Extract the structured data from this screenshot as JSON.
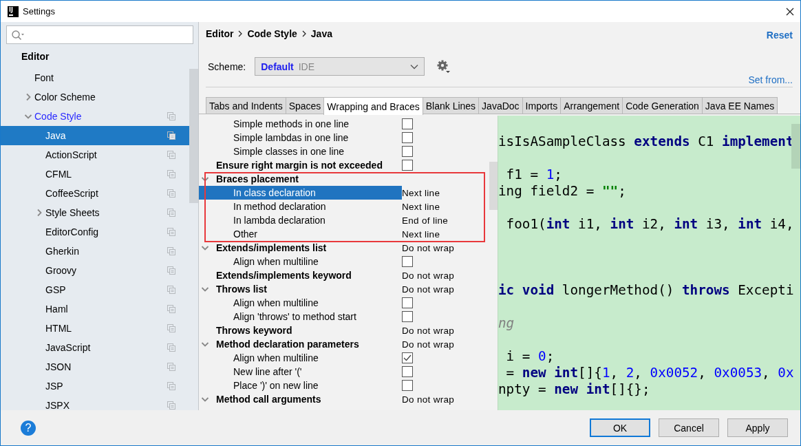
{
  "window": {
    "icon_label": "IJ",
    "title": "Settings"
  },
  "sidebar": {
    "heading": "Editor",
    "items": [
      {
        "label": "Font",
        "selected": false,
        "modified": false,
        "scheme_icon": false
      },
      {
        "label": "Color Scheme",
        "selected": false,
        "modified": false,
        "scheme_icon": false,
        "expanded": false
      },
      {
        "label": "Code Style",
        "selected": false,
        "modified": true,
        "scheme_icon": true,
        "expanded": true,
        "children": [
          {
            "label": "Java",
            "selected": true,
            "modified": false,
            "scheme_icon": true
          },
          {
            "label": "ActionScript",
            "selected": false,
            "modified": false,
            "scheme_icon": true
          },
          {
            "label": "CFML",
            "selected": false,
            "modified": false,
            "scheme_icon": true
          },
          {
            "label": "CoffeeScript",
            "selected": false,
            "modified": false,
            "scheme_icon": true
          },
          {
            "label": "Style Sheets",
            "selected": false,
            "modified": false,
            "scheme_icon": true,
            "expanded": false
          },
          {
            "label": "EditorConfig",
            "selected": false,
            "modified": false,
            "scheme_icon": true
          },
          {
            "label": "Gherkin",
            "selected": false,
            "modified": false,
            "scheme_icon": true
          },
          {
            "label": "Groovy",
            "selected": false,
            "modified": false,
            "scheme_icon": true
          },
          {
            "label": "GSP",
            "selected": false,
            "modified": false,
            "scheme_icon": true
          },
          {
            "label": "Haml",
            "selected": false,
            "modified": false,
            "scheme_icon": true
          },
          {
            "label": "HTML",
            "selected": false,
            "modified": false,
            "scheme_icon": true
          },
          {
            "label": "JavaScript",
            "selected": false,
            "modified": false,
            "scheme_icon": true
          },
          {
            "label": "JSON",
            "selected": false,
            "modified": false,
            "scheme_icon": true
          },
          {
            "label": "JSP",
            "selected": false,
            "modified": false,
            "scheme_icon": true
          },
          {
            "label": "JSPX",
            "selected": false,
            "modified": false,
            "scheme_icon": true
          }
        ]
      }
    ]
  },
  "breadcrumb": [
    "Editor",
    "Code Style",
    "Java"
  ],
  "reset_link": "Reset",
  "scheme": {
    "label": "Scheme:",
    "name": "Default",
    "type": "IDE"
  },
  "set_from_link": "Set from...",
  "tabs": [
    {
      "label": "Tabs and Indents",
      "selected": false
    },
    {
      "label": "Spaces",
      "selected": false
    },
    {
      "label": "Wrapping and Braces",
      "selected": true
    },
    {
      "label": "Blank Lines",
      "selected": false
    },
    {
      "label": "JavaDoc",
      "selected": false
    },
    {
      "label": "Imports",
      "selected": false
    },
    {
      "label": "Arrangement",
      "selected": false
    },
    {
      "label": "Code Generation",
      "selected": false
    },
    {
      "label": "Java EE Names",
      "selected": false
    }
  ],
  "options": [
    {
      "kind": "continued",
      "children": [
        {
          "kind": "checkbox",
          "label": "Simple methods in one line",
          "checked": false,
          "selected": false
        },
        {
          "kind": "checkbox",
          "label": "Simple lambdas in one line",
          "checked": false,
          "selected": false
        },
        {
          "kind": "checkbox",
          "label": "Simple classes in one line",
          "checked": false,
          "selected": false
        }
      ]
    },
    {
      "kind": "checkbox",
      "label": "Ensure right margin is not exceeded",
      "checked": false,
      "selected": false
    },
    {
      "kind": "heading",
      "label": "Braces placement",
      "expanded": true,
      "highlighted": true,
      "selected": false,
      "children": [
        {
          "kind": "choice",
          "label": "In class declaration",
          "value": "Next line",
          "selected": true
        },
        {
          "kind": "choice",
          "label": "In method declaration",
          "value": "Next line",
          "selected": false
        },
        {
          "kind": "choice",
          "label": "In lambda declaration",
          "value": "End of line",
          "selected": false
        },
        {
          "kind": "choice",
          "label": "Other",
          "value": "Next line",
          "selected": false
        }
      ]
    },
    {
      "kind": "choice",
      "label": "Extends/implements list",
      "value": "Do not wrap",
      "expanded": true,
      "highlighted": false,
      "selected": false,
      "children": [
        {
          "kind": "checkbox",
          "label": "Align when multiline",
          "checked": false,
          "selected": false
        }
      ]
    },
    {
      "kind": "choice",
      "label": "Extends/implements keyword",
      "value": "Do not wrap",
      "selected": false
    },
    {
      "kind": "choice",
      "label": "Throws list",
      "value": "Do not wrap",
      "expanded": true,
      "highlighted": false,
      "selected": false,
      "children": [
        {
          "kind": "checkbox",
          "label": "Align when multiline",
          "checked": false,
          "selected": false
        },
        {
          "kind": "checkbox",
          "label": "Align 'throws' to method start",
          "checked": false,
          "selected": false
        }
      ]
    },
    {
      "kind": "choice",
      "label": "Throws keyword",
      "value": "Do not wrap",
      "selected": false
    },
    {
      "kind": "choice",
      "label": "Method declaration parameters",
      "value": "Do not wrap",
      "expanded": true,
      "highlighted": false,
      "selected": false,
      "children": [
        {
          "kind": "checkbox",
          "label": "Align when multiline",
          "checked": true,
          "selected": false
        },
        {
          "kind": "checkbox",
          "label": "New line after '('",
          "checked": false,
          "selected": false
        },
        {
          "kind": "checkbox",
          "label": "Place ')' on new line",
          "checked": false,
          "selected": false
        }
      ]
    },
    {
      "kind": "choice",
      "label": "Method call arguments",
      "value": "Do not wrap",
      "expanded": true,
      "highlighted": false,
      "selected": false
    }
  ],
  "code_preview": [
    {
      "kind": "blank"
    },
    {
      "kind": "code",
      "tokens": [
        {
          "kind": "plain",
          "text": "isIsASampleClass "
        },
        {
          "kind": "keyword",
          "text": "extends"
        },
        {
          "kind": "plain",
          "text": " C1 "
        },
        {
          "kind": "keyword",
          "text": "implement"
        }
      ]
    },
    {
      "kind": "blank"
    },
    {
      "kind": "code",
      "tokens": [
        {
          "kind": "plain",
          "text": " f1 = "
        },
        {
          "kind": "number",
          "text": "1"
        },
        {
          "kind": "plain",
          "text": ";"
        }
      ]
    },
    {
      "kind": "code",
      "tokens": [
        {
          "kind": "plain",
          "text": "ing field2 = "
        },
        {
          "kind": "string",
          "text": "\"\""
        },
        {
          "kind": "plain",
          "text": ";"
        }
      ]
    },
    {
      "kind": "blank"
    },
    {
      "kind": "code",
      "tokens": [
        {
          "kind": "plain",
          "text": " foo1("
        },
        {
          "kind": "keyword",
          "text": "int"
        },
        {
          "kind": "plain",
          "text": " i1, "
        },
        {
          "kind": "keyword",
          "text": "int"
        },
        {
          "kind": "plain",
          "text": " i2, "
        },
        {
          "kind": "keyword",
          "text": "int"
        },
        {
          "kind": "plain",
          "text": " i3, "
        },
        {
          "kind": "keyword",
          "text": "int"
        },
        {
          "kind": "plain",
          "text": " i4,"
        }
      ]
    },
    {
      "kind": "blank"
    },
    {
      "kind": "blank"
    },
    {
      "kind": "blank"
    },
    {
      "kind": "code",
      "tokens": [
        {
          "kind": "keyword",
          "text": "ic"
        },
        {
          "kind": "keyword",
          "text": " void"
        },
        {
          "kind": "plain",
          "text": " longerMethod() "
        },
        {
          "kind": "keyword",
          "text": "throws"
        },
        {
          "kind": "plain",
          "text": " Excepti"
        }
      ]
    },
    {
      "kind": "blank"
    },
    {
      "kind": "code",
      "tokens": [
        {
          "kind": "comment",
          "text": "ng"
        }
      ]
    },
    {
      "kind": "blank"
    },
    {
      "kind": "code",
      "tokens": [
        {
          "kind": "plain",
          "text": " i = "
        },
        {
          "kind": "number",
          "text": "0"
        },
        {
          "kind": "plain",
          "text": ";"
        }
      ]
    },
    {
      "kind": "code",
      "tokens": [
        {
          "kind": "plain",
          "text": " = "
        },
        {
          "kind": "keyword",
          "text": "new"
        },
        {
          "kind": "keyword",
          "text": " int"
        },
        {
          "kind": "plain",
          "text": "[]{"
        },
        {
          "kind": "number",
          "text": "1"
        },
        {
          "kind": "plain",
          "text": ", "
        },
        {
          "kind": "number",
          "text": "2"
        },
        {
          "kind": "plain",
          "text": ", "
        },
        {
          "kind": "number",
          "text": "0x0052"
        },
        {
          "kind": "plain",
          "text": ", "
        },
        {
          "kind": "number",
          "text": "0x0053"
        },
        {
          "kind": "plain",
          "text": ", "
        },
        {
          "kind": "number",
          "text": "0x"
        }
      ]
    },
    {
      "kind": "code",
      "tokens": [
        {
          "kind": "plain",
          "text": "npty = "
        },
        {
          "kind": "keyword",
          "text": "new"
        },
        {
          "kind": "keyword",
          "text": " int"
        },
        {
          "kind": "plain",
          "text": "[]{};"
        }
      ]
    }
  ],
  "help_button": "?",
  "buttons": [
    {
      "label": "OK",
      "focused": true
    },
    {
      "label": "Cancel",
      "focused": false
    },
    {
      "label": "Apply",
      "focused": false
    }
  ]
}
